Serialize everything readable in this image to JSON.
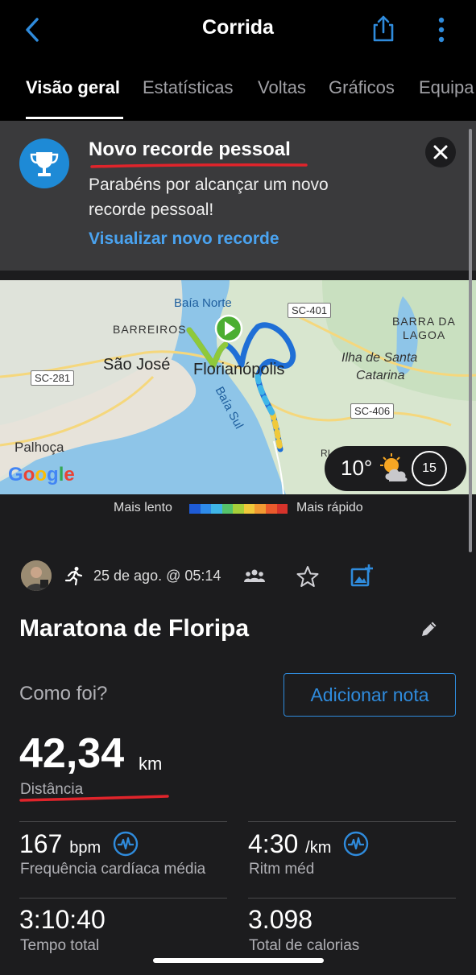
{
  "header": {
    "title": "Corrida",
    "back_icon": "chevron-left-icon",
    "share_icon": "share-icon",
    "more_icon": "more-vertical-icon"
  },
  "tabs": [
    {
      "label": "Visão geral",
      "active": true
    },
    {
      "label": "Estatísticas",
      "active": false
    },
    {
      "label": "Voltas",
      "active": false
    },
    {
      "label": "Gráficos",
      "active": false
    },
    {
      "label": "Equipa",
      "active": false
    }
  ],
  "banner": {
    "title": "Novo recorde pessoal",
    "message": "Parabéns por alcançar um novo recorde pessoal!",
    "link": "Visualizar novo recorde",
    "icon": "trophy-icon",
    "close_icon": "close-icon"
  },
  "map": {
    "labels": {
      "baia_norte": "Baía Norte",
      "sc401": "SC-401",
      "barreiros": "BARREIROS",
      "barra_da": "BARRA DA",
      "lagoa": "LAGOA",
      "sao_jose": "São José",
      "florianopolis": "Florianópolis",
      "ilha_line1": "Ilha de Santa",
      "ilha_line2": "Catarina",
      "sc281": "SC-281",
      "sc406": "SC-406",
      "baia_sul": "Baía Sul",
      "palhoca": "Palhoça",
      "ri": "RI"
    },
    "logo": "Google",
    "weather": {
      "temperature": "10°",
      "icon": "partly-cloudy-icon",
      "wind": "15"
    }
  },
  "legend": {
    "slow": "Mais lento",
    "fast": "Mais rápido",
    "colors": [
      "#1e5bd6",
      "#2e8bea",
      "#3fb6e8",
      "#55c36b",
      "#a7cf3a",
      "#f0c93a",
      "#f29a32",
      "#ea5a2c",
      "#d6332b"
    ]
  },
  "activity": {
    "date": "25 de ago. @ 05:14",
    "name": "Maratona de Floripa",
    "how_label": "Como foi?",
    "note_button": "Adicionar nota"
  },
  "distance": {
    "value": "42,34",
    "unit": "km",
    "label": "Distância"
  },
  "stats": [
    {
      "value": "167",
      "unit": "bpm",
      "label": "Frequência cardíaca média",
      "icon": "heart-rate-icon"
    },
    {
      "value": "4:30",
      "unit": "/km",
      "label": "Ritm méd",
      "icon": "heart-rate-icon"
    },
    {
      "value": "3:10:40",
      "unit": "",
      "label": "Tempo total"
    },
    {
      "value": "3.098",
      "unit": "",
      "label": "Total de calorias"
    }
  ],
  "colors": {
    "accent": "#2f8bdc",
    "link": "#4aa3f0",
    "underline": "#e0242b",
    "banner_bg": "#3a3a3c",
    "page_bg": "#1c1c1e"
  }
}
